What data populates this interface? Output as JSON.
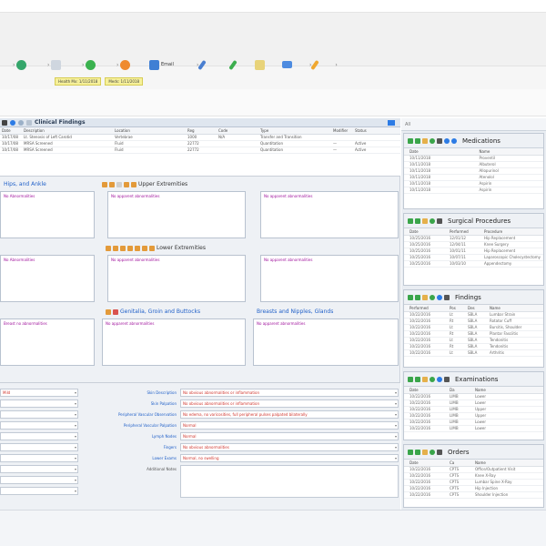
{
  "colors": {
    "accent": "#1f5fc8",
    "magenta": "#a0129c",
    "red": "#d0342c",
    "note": "#f6f09a"
  },
  "toolbar": {
    "items": [
      {
        "icon": "green-circle-icon",
        "label": ""
      },
      {
        "icon": "document-icon",
        "label": ""
      },
      {
        "icon": "green-plus-icon",
        "label": ""
      },
      {
        "icon": "orange-clock-icon",
        "label": ""
      },
      {
        "icon": "blue-screen-icon",
        "label": "Email"
      },
      {
        "icon": "pencil-icon",
        "label": ""
      },
      {
        "icon": "green-pen-icon",
        "label": ""
      },
      {
        "icon": "clipboard-icon",
        "label": ""
      },
      {
        "icon": "blue-window-icon",
        "label": ""
      },
      {
        "icon": "brush-icon",
        "label": ""
      }
    ],
    "notes": [
      "Health Mx: 1/11/2018",
      "Meds: 1/11/2018"
    ]
  },
  "exam": {
    "title": "Clinical Findings",
    "columns": [
      "Date",
      "Description",
      "Location",
      "Reg",
      "Code",
      "Type",
      "Modifier",
      "Status"
    ],
    "rows": [
      [
        "10/17/08",
        "Lt. Stenosis of Left Carotid",
        "Vertebrae",
        "1000",
        "N/A",
        "Transfer and Transition",
        "",
        ""
      ],
      [
        "10/17/08",
        "MRSA Screened",
        "Fluid",
        "22772",
        "",
        "Quantitation",
        "—",
        "Active"
      ],
      [
        "10/17/08",
        "MRSA Screened",
        "Fluid",
        "22772",
        "",
        "Quantitation",
        "—",
        "Active"
      ]
    ]
  },
  "sections": {
    "s1": {
      "title": "Hips, and Ankle",
      "left_text": "No Abnormalities"
    },
    "s2": {
      "title": "Upper Extremities",
      "text_a": "No apparent abnormalities",
      "text_b": "No apparent abnormalities"
    },
    "s3": {
      "title": "Lower Extremities",
      "left_text": "No Abnormalities",
      "text_a": "No apparent abnormalities",
      "text_b": "No apparent abnormalities"
    },
    "s4": {
      "title": "Genitalia, Groin and Buttocks",
      "title2": "Breasts and Nipples, Glands",
      "left_text": "Breast no abnormalities",
      "text_a": "No apparent abnormalities",
      "text_b": "No apparent abnormalities"
    }
  },
  "form": {
    "left_rows": [
      "Mild",
      "",
      "",
      "",
      "",
      "",
      "",
      "",
      "",
      ""
    ],
    "fields": [
      {
        "label": "Skin Description",
        "value": "No obvious abnormalities or inflammation"
      },
      {
        "label": "Skin Palpation",
        "value": "No obvious abnormalities or inflammation"
      },
      {
        "label": "Peripheral Vascular Observation",
        "value": "No edema, no varicosities, full peripheral pulses palpated bilaterally"
      },
      {
        "label": "Peripheral Vascular Palpation",
        "value": "Normal"
      },
      {
        "label": "Lymph Nodes",
        "value": "Normal"
      },
      {
        "label": "Fingers",
        "value": "No obvious abnormalities"
      },
      {
        "label": "Lower Exams",
        "value": "Normal, no swelling"
      },
      {
        "label": "Additional Notes",
        "value": ""
      }
    ]
  },
  "right": {
    "caption": "All",
    "medications": {
      "title": "Medications",
      "columns": [
        "Date",
        "Name"
      ],
      "rows": [
        [
          "10/11/2018",
          "Proventil"
        ],
        [
          "10/11/2018",
          "Albuterol"
        ],
        [
          "10/11/2018",
          "Allopurinol"
        ],
        [
          "10/11/2018",
          "Atenolol"
        ],
        [
          "10/11/2018",
          "Aspirin"
        ],
        [
          "10/11/2018",
          "Aspirin"
        ]
      ]
    },
    "procedures": {
      "title": "Surgical Procedures",
      "columns": [
        "Date",
        "Performed",
        "Procedure"
      ],
      "rows": [
        [
          "10/25/2016",
          "12/01/12",
          "Hip Replacement"
        ],
        [
          "10/25/2016",
          "12/04/11",
          "Knee Surgery"
        ],
        [
          "10/25/2016",
          "10/01/11",
          "Hip Replacement"
        ],
        [
          "10/25/2016",
          "10/07/11",
          "Laparoscopic Cholecystectomy"
        ],
        [
          "10/25/2016",
          "10/03/10",
          "Appendectomy"
        ]
      ]
    },
    "findings": {
      "title": "Findings",
      "columns": [
        "Performed",
        "Pos",
        "Des",
        "Name"
      ],
      "rows": [
        [
          "10/22/2016",
          "Lt",
          "SBLA",
          "Lumbar Strain"
        ],
        [
          "10/22/2016",
          "Rt",
          "SBLA",
          "Rotator Cuff"
        ],
        [
          "10/22/2016",
          "Lt",
          "SBLA",
          "Bursitis, Shoulder"
        ],
        [
          "10/22/2016",
          "Rt",
          "SBLA",
          "Plantar Fasciitis"
        ],
        [
          "10/22/2016",
          "Lt",
          "SBLA",
          "Tendonitis"
        ],
        [
          "10/22/2016",
          "Rt",
          "SBLA",
          "Tendonitis"
        ],
        [
          "10/22/2016",
          "Lt",
          "SBLA",
          "Arthritis"
        ]
      ]
    },
    "examinations": {
      "title": "Examinations",
      "columns": [
        "Date",
        "Da",
        "Name"
      ],
      "rows": [
        [
          "10/22/2016",
          "LIMB",
          "Lower"
        ],
        [
          "10/22/2016",
          "LIMB",
          "Lower"
        ],
        [
          "10/22/2016",
          "LIMB",
          "Upper"
        ],
        [
          "10/22/2016",
          "LIMB",
          "Upper"
        ],
        [
          "10/22/2016",
          "LIMB",
          "Lower"
        ],
        [
          "10/22/2016",
          "LIMB",
          "Lower"
        ]
      ]
    },
    "orders": {
      "title": "Orders",
      "columns": [
        "Date",
        "Ca",
        "Name"
      ],
      "rows": [
        [
          "10/22/2016",
          "CPTS",
          "Office/Outpatient Visit"
        ],
        [
          "10/22/2016",
          "CPTS",
          "Knee X-Ray"
        ],
        [
          "10/22/2016",
          "CPTS",
          "Lumbar Spine X-Ray"
        ],
        [
          "10/22/2016",
          "CPTS",
          "Hip Injection"
        ],
        [
          "10/22/2016",
          "CPTS",
          "Shoulder Injection"
        ]
      ]
    }
  }
}
